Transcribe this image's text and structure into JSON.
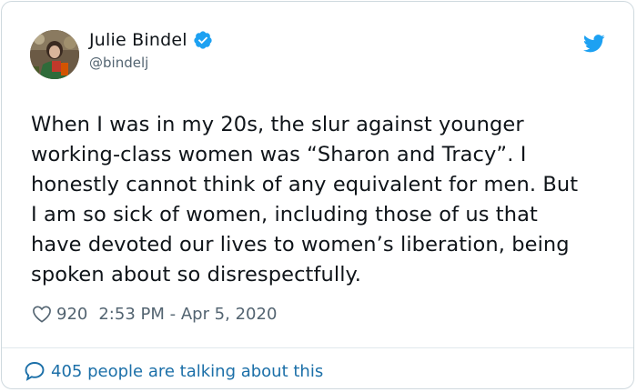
{
  "author": {
    "display_name": "Julie Bindel",
    "handle": "@bindelj"
  },
  "tweet": {
    "text": "When I was in my 20s, the slur against younger\nworking-class women was “Sharon and Tracy”. I\nhonestly cannot think of any equivalent for men. But\nI am so sick of women, including those of us that\nhave devoted our lives to women’s liberation, being\nspoken about so disrespectfully."
  },
  "meta": {
    "like_count": "920",
    "timestamp": "2:53 PM - Apr 5, 2020"
  },
  "footer": {
    "talking_text": "405 people are talking about this"
  },
  "icons": {
    "verified": "verified-badge-icon",
    "twitter": "twitter-bird-icon",
    "like": "heart-icon",
    "reply": "speech-bubble-icon"
  },
  "colors": {
    "twitter_blue": "#1da1f2",
    "text_primary": "#0f1419",
    "text_secondary": "#536471",
    "link": "#1b6fa8"
  }
}
